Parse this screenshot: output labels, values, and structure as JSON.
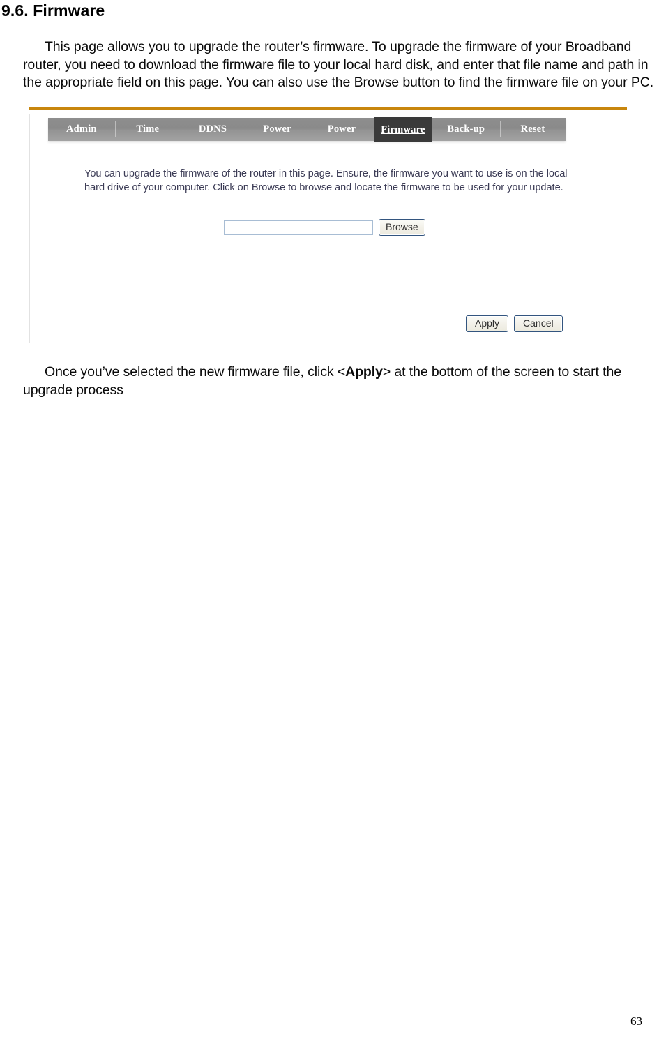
{
  "document": {
    "heading": "9.6. Firmware",
    "intro_paragraph_before_bold": "This page allows you to upgrade the router’s firmware. To upgrade the firmware of your Broadband router, you need to download the firmware file to your local hard disk, and enter that file name and path in the appropriate field on this page. You can also use the Browse button to find the firmware file on your PC.",
    "closing_paragraph_part1": "Once you’ve selected the new firmware file, click <",
    "closing_paragraph_bold": "Apply",
    "closing_paragraph_part2": "> at the bottom of the screen to start the upgrade process",
    "page_number": "63"
  },
  "router_ui": {
    "tabs": [
      {
        "label": "Admin",
        "active": false
      },
      {
        "label": "Time",
        "active": false
      },
      {
        "label": "DDNS",
        "active": false
      },
      {
        "label": "Power",
        "active": false
      },
      {
        "label": "Power",
        "active": false
      },
      {
        "label": "Firmware",
        "active": true
      },
      {
        "label": "Back-up",
        "active": false
      },
      {
        "label": "Reset",
        "active": false
      }
    ],
    "description": "You can upgrade the firmware of the router in this page. Ensure, the firmware you want to use is on the local hard drive of your computer. Click on Browse to browse and locate the firmware to be used for your update.",
    "file_field": {
      "value": "",
      "placeholder": ""
    },
    "browse_label": "Browse",
    "apply_label": "Apply",
    "cancel_label": "Cancel"
  },
  "colors": {
    "gold_rule": "#c8860d",
    "tab_bar_gray": "#8e8e8e",
    "tab_active_dark": "#3a3a3a",
    "panel_text": "#3b3b55",
    "button_border_blue": "#33557f",
    "input_border_blue": "#a8bdd4"
  }
}
